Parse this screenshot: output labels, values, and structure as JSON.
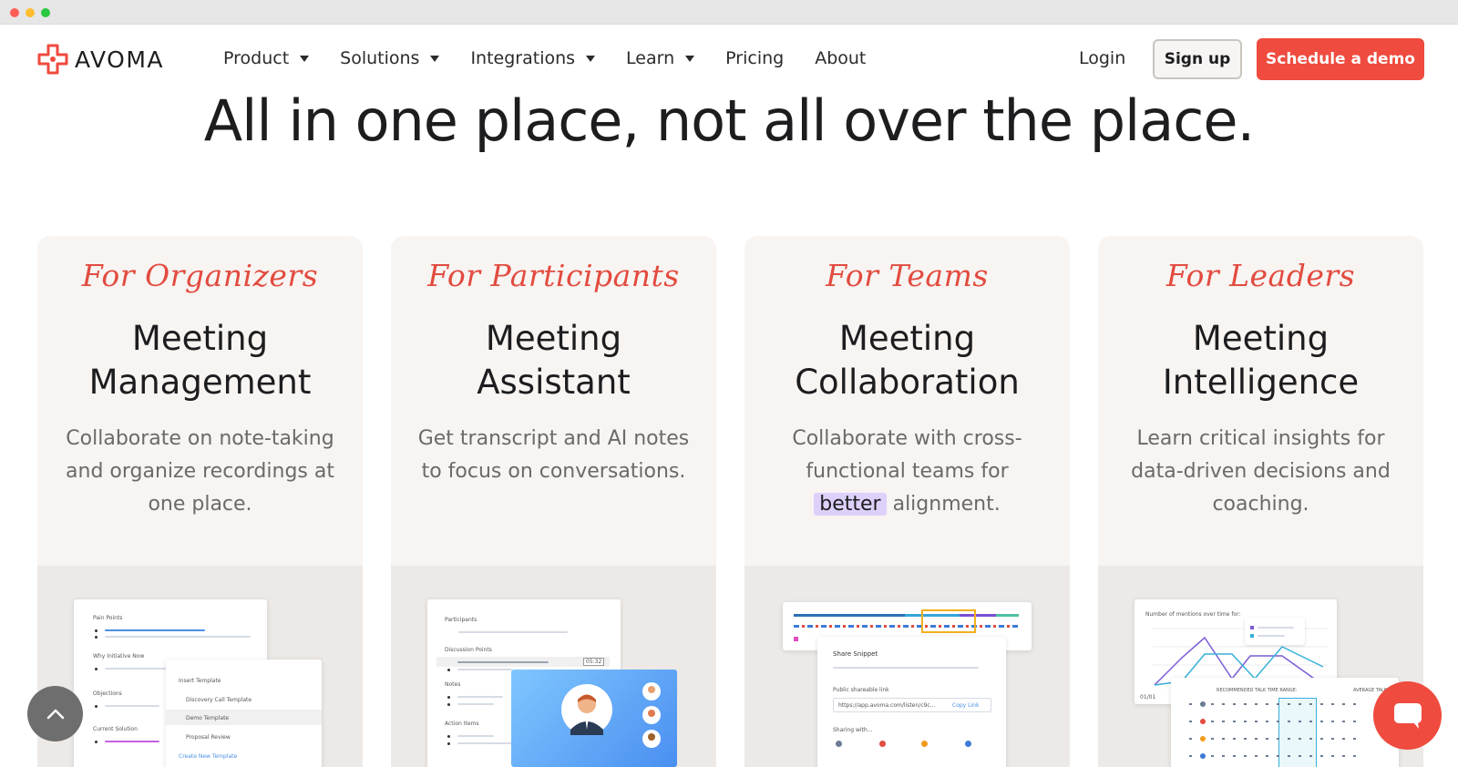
{
  "nav": {
    "logo_text": "AVOMA",
    "menu": [
      {
        "label": "Product",
        "has_caret": true
      },
      {
        "label": "Solutions",
        "has_caret": true
      },
      {
        "label": "Integrations",
        "has_caret": true
      },
      {
        "label": "Learn",
        "has_caret": true
      },
      {
        "label": "Pricing",
        "has_caret": false
      },
      {
        "label": "About",
        "has_caret": false
      }
    ],
    "login": "Login",
    "signup": "Sign up",
    "demo": "Schedule a demo"
  },
  "hero": {
    "title": "All in one place, not all over the place."
  },
  "cards": [
    {
      "kicker": "For Organizers",
      "title_1": "Meeting",
      "title_2": "Management",
      "desc": "Collaborate on note-taking and organize recordings at one place."
    },
    {
      "kicker": "For Participants",
      "title_1": "Meeting",
      "title_2": "Assistant",
      "desc": "Get transcript and AI notes to focus on conversations."
    },
    {
      "kicker": "For Teams",
      "title_1": "Meeting",
      "title_2": "Collaboration",
      "desc_before": "Collaborate with cross-functional teams for ",
      "desc_highlight": "better",
      "desc_after": " alignment."
    },
    {
      "kicker": "For Leaders",
      "title_1": "Meeting",
      "title_2": "Intelligence",
      "desc": "Learn critical insights for data-driven decisions and coaching."
    }
  ],
  "mock1": {
    "pain_points": "Pain Points",
    "why_now": "Why Initiative Now",
    "objections": "Objections",
    "current_solution": "Current Solution",
    "insert_template": "Insert Template",
    "discovery": "Discovery Call Template",
    "demo_template": "Demo Template",
    "proposal": "Proposal Review",
    "create_new": "Create New Template"
  },
  "mock2": {
    "participants": "Participants",
    "discussion": "Discussion Points",
    "notes": "Notes",
    "action_items": "Action Items",
    "timestamp": "05:32"
  },
  "mock3": {
    "share_snippet": "Share Snippet",
    "public_link": "Public shareable link",
    "url": "https://app.avoma.com/listen/c9c...",
    "copy_link": "Copy Link",
    "sharing_with": "Sharing with..."
  },
  "mock4": {
    "chart_title": "Number of mentions over time for:",
    "range_label": "RECOMMENDED TALK TIME RANGE:",
    "average": "AVERAGE TALK TIME",
    "date_label": "01/01"
  },
  "colors": {
    "accent": "#ef4b3f",
    "highlight": "#ddd0fb",
    "card_bg": "#f7f4f2"
  }
}
